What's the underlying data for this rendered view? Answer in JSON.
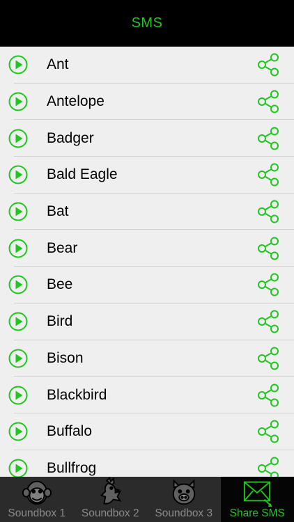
{
  "header": {
    "title": "SMS"
  },
  "colors": {
    "accent": "#1EC61E",
    "navbar_bg": "#000000",
    "list_bg": "#EFEFEF",
    "tabbar_bg": "#2B2B2B"
  },
  "rows": [
    {
      "label": "Ant",
      "play_icon": "play-circle-icon",
      "share_icon": "share-icon"
    },
    {
      "label": "Antelope",
      "play_icon": "play-circle-icon",
      "share_icon": "share-icon"
    },
    {
      "label": "Badger",
      "play_icon": "play-circle-icon",
      "share_icon": "share-icon"
    },
    {
      "label": "Bald Eagle",
      "play_icon": "play-circle-icon",
      "share_icon": "share-icon"
    },
    {
      "label": "Bat",
      "play_icon": "play-circle-icon",
      "share_icon": "share-icon"
    },
    {
      "label": "Bear",
      "play_icon": "play-circle-icon",
      "share_icon": "share-icon"
    },
    {
      "label": "Bee",
      "play_icon": "play-circle-icon",
      "share_icon": "share-icon"
    },
    {
      "label": "Bird",
      "play_icon": "play-circle-icon",
      "share_icon": "share-icon"
    },
    {
      "label": "Bison",
      "play_icon": "play-circle-icon",
      "share_icon": "share-icon"
    },
    {
      "label": "Blackbird",
      "play_icon": "play-circle-icon",
      "share_icon": "share-icon"
    },
    {
      "label": "Buffalo",
      "play_icon": "play-circle-icon",
      "share_icon": "share-icon"
    },
    {
      "label": "Bullfrog",
      "play_icon": "play-circle-icon",
      "share_icon": "share-icon"
    }
  ],
  "tabs": [
    {
      "label": "Soundbox 1",
      "icon": "monkey-icon",
      "active": false
    },
    {
      "label": "Soundbox 2",
      "icon": "rooster-icon",
      "active": false
    },
    {
      "label": "Soundbox 3",
      "icon": "pig-icon",
      "active": false
    },
    {
      "label": "Share SMS",
      "icon": "envelope-icon",
      "active": true
    }
  ]
}
